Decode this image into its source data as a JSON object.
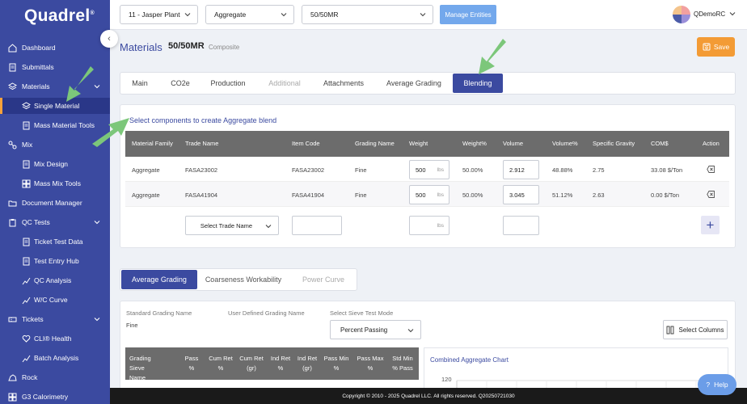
{
  "app": {
    "logo_text": "Quadrel",
    "logo_mark": "®"
  },
  "sidebar": {
    "items": [
      {
        "label": "Dashboard",
        "icon": "home-icon"
      },
      {
        "label": "Submittals",
        "icon": "document-icon"
      },
      {
        "label": "Materials",
        "icon": "layers-icon"
      },
      {
        "label": "Single Material",
        "icon": "layers-icon"
      },
      {
        "label": "Mass Material Tools",
        "icon": "document-icon"
      },
      {
        "label": "Mix",
        "icon": "mix-icon"
      },
      {
        "label": "Mix Design",
        "icon": "document-icon"
      },
      {
        "label": "Mass Mix Tools",
        "icon": "grid-icon"
      },
      {
        "label": "Document Manager",
        "icon": "folder-icon"
      },
      {
        "label": "QC Tests",
        "icon": "clipboard-icon"
      },
      {
        "label": "Ticket Test Data",
        "icon": "document-icon"
      },
      {
        "label": "Test Entry Hub",
        "icon": "document-icon"
      },
      {
        "label": "QC Analysis",
        "icon": "chart-icon"
      },
      {
        "label": "W/C Curve",
        "icon": "chart-icon"
      },
      {
        "label": "Tickets",
        "icon": "ticket-icon"
      },
      {
        "label": "CLI® Health",
        "icon": "heart-icon"
      },
      {
        "label": "Batch Analysis",
        "icon": "chart-icon"
      },
      {
        "label": "Rock",
        "icon": "rock-icon"
      },
      {
        "label": "G3 Calorimetry",
        "icon": "grid-icon"
      }
    ]
  },
  "topbar": {
    "plant": "11 - Jasper Plant",
    "category": "Aggregate",
    "entity": "50/50MR",
    "manage_label": "Manage Entities",
    "user": "QDemoRC"
  },
  "header": {
    "title": "Materials",
    "material": "50/50MR",
    "tag": "Composite",
    "save_label": "Save"
  },
  "tabs": [
    "Main",
    "CO2e",
    "Production",
    "Additional",
    "Attachments",
    "Average Grading",
    "Blending"
  ],
  "blending": {
    "heading": "Select components to create Aggregate blend",
    "columns": [
      "Material Family",
      "Trade Name",
      "Item Code",
      "Grading Name",
      "Weight",
      "Weight%",
      "Volume",
      "Volume%",
      "Specific Gravity",
      "COM$",
      "Action"
    ],
    "rows": [
      {
        "family": "Aggregate",
        "trade": "FASA23002",
        "code": "FASA23002",
        "grading": "Fine",
        "weight": "500",
        "weight_unit": "lbs",
        "weight_pct": "50.00%",
        "volume": "2.912",
        "volume_pct": "48.88%",
        "sg": "2.75",
        "com": "33.08 $/Ton"
      },
      {
        "family": "Aggregate",
        "trade": "FASA41904",
        "code": "FASA41904",
        "grading": "Fine",
        "weight": "500",
        "weight_unit": "lbs",
        "weight_pct": "50.00%",
        "volume": "3.045",
        "volume_pct": "51.12%",
        "sg": "2.63",
        "com": "0.00 $/Ton"
      }
    ],
    "new_row": {
      "trade_placeholder": "Select Trade Name",
      "weight_unit": "lbs"
    }
  },
  "grading_tabs": [
    "Average Grading",
    "Coarseness Workability",
    "Power Curve"
  ],
  "grading": {
    "std_label": "Standard Grading Name",
    "std_value": "Fine",
    "user_label": "User Defined Grading Name",
    "mode_label": "Select Sieve Test Mode",
    "mode_value": "Percent Passing",
    "select_columns": "Select Columns",
    "columns": [
      [
        "Grading",
        "Sieve Name"
      ],
      [
        "Pass",
        "%"
      ],
      [
        "Cum Ret",
        "%"
      ],
      [
        "Cum Ret",
        "(gr)"
      ],
      [
        "Ind Ret",
        "%"
      ],
      [
        "Ind Ret",
        "(gr)"
      ],
      [
        "Pass Min",
        "%"
      ],
      [
        "Pass Max",
        "%"
      ],
      [
        "Std Min",
        "% Pass"
      ]
    ]
  },
  "chart": {
    "title": "Combined Aggregate Chart",
    "ytick": "120"
  },
  "footer": {
    "text": "Copyright © 2010 - 2025 Quadrel LLC. All rights reserved. Q20250721030"
  },
  "help": {
    "label": "Help"
  }
}
